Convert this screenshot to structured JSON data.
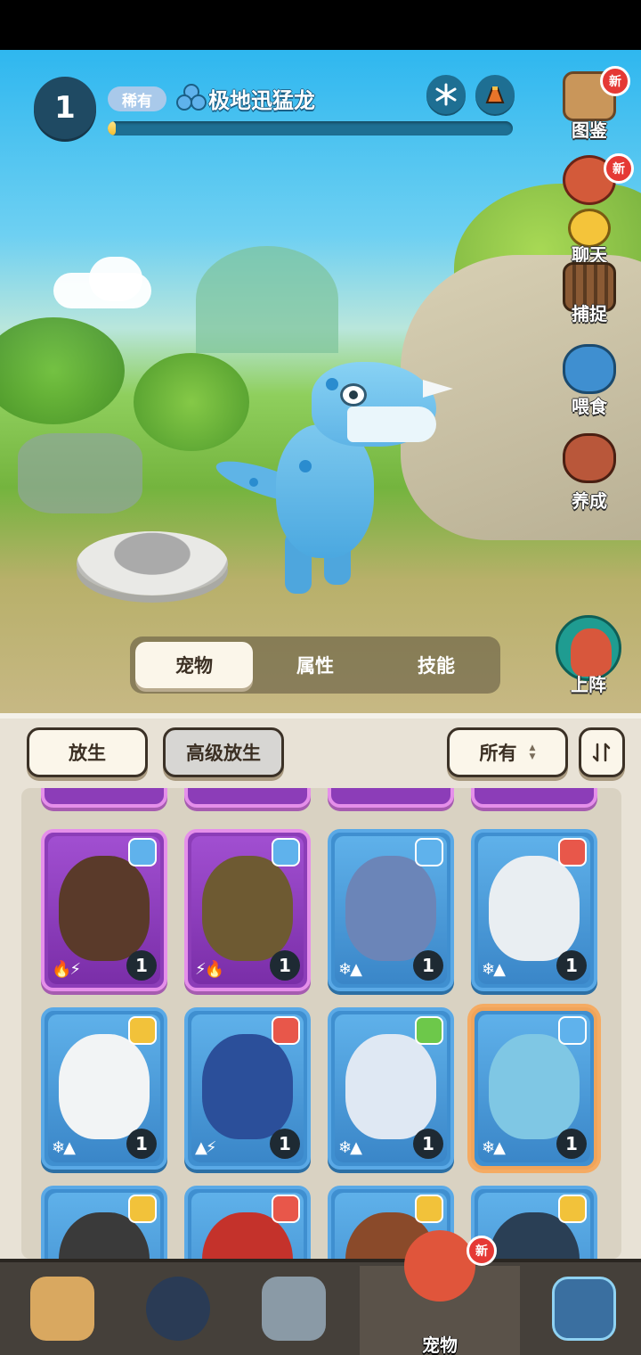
{
  "header": {
    "level": "1",
    "rarity": "稀有",
    "pet_name": "极地迅猛龙",
    "xp_progress_percent": 2,
    "element_icons": [
      "snowflake-icon",
      "volcano-icon"
    ]
  },
  "side_menu": [
    {
      "label": "图鉴",
      "badge": "新",
      "icon": "book-icon"
    },
    {
      "label": "",
      "badge": "新",
      "icon": "stall-icon"
    },
    {
      "label": "聊天",
      "badge": "",
      "icon": "chat-icon"
    },
    {
      "label": "捕捉",
      "badge": "",
      "icon": "cage-icon"
    },
    {
      "label": "喂食",
      "badge": "",
      "icon": "feed-icon"
    },
    {
      "label": "养成",
      "badge": "",
      "icon": "nurture-icon"
    }
  ],
  "detail_tabs": [
    "宠物",
    "属性",
    "技能"
  ],
  "active_detail_tab": 0,
  "deploy_label": "上阵",
  "panel": {
    "release_label": "放生",
    "advanced_release_label": "高级放生",
    "filter_label": "所有",
    "sort_icon": "sort-icon"
  },
  "pet_cards": [
    {
      "level": "1",
      "frame": "purple",
      "type_icon": "water-icon",
      "elements": "🔥⚡",
      "creature_color": "#5a3a2a"
    },
    {
      "level": "1",
      "frame": "purple",
      "type_icon": "water-icon",
      "elements": "⚡🔥",
      "creature_color": "#6e5a32"
    },
    {
      "level": "1",
      "frame": "blue",
      "type_icon": "water-icon",
      "elements": "❄▲",
      "creature_color": "#6b85b8"
    },
    {
      "level": "1",
      "frame": "blue",
      "type_icon": "fire-paw-icon",
      "elements": "❄▲",
      "creature_color": "#e9eef2"
    },
    {
      "level": "1",
      "frame": "blue",
      "type_icon": "earth-icon",
      "elements": "❄▲",
      "creature_color": "#f2f4f5"
    },
    {
      "level": "1",
      "frame": "blue",
      "type_icon": "fire-paw-icon",
      "elements": "▲⚡",
      "creature_color": "#2b4f9a"
    },
    {
      "level": "1",
      "frame": "blue",
      "type_icon": "leaf-heart-icon",
      "elements": "❄▲",
      "creature_color": "#dfe8f3"
    },
    {
      "level": "1",
      "frame": "blue",
      "type_icon": "water-icon",
      "elements": "❄▲",
      "creature_color": "#7fc7e4"
    },
    {
      "level": "",
      "frame": "blue",
      "type_icon": "earth-icon",
      "elements": "",
      "creature_color": "#3a3a3a"
    },
    {
      "level": "",
      "frame": "blue",
      "type_icon": "fire-paw-icon",
      "elements": "",
      "creature_color": "#c4322b"
    },
    {
      "level": "",
      "frame": "blue",
      "type_icon": "earth-icon",
      "elements": "",
      "creature_color": "#8a4a2a"
    },
    {
      "level": "",
      "frame": "blue",
      "type_icon": "earth-icon",
      "elements": "",
      "creature_color": "#2a3f55"
    }
  ],
  "selected_card_index": 7,
  "bottom_nav": [
    {
      "label": "",
      "icon": "tribe-icon"
    },
    {
      "label": "",
      "icon": "hero-icon"
    },
    {
      "label": "",
      "icon": "weapon-icon"
    },
    {
      "label": "宠物",
      "icon": "pet-icon",
      "badge": "新"
    },
    {
      "label": "",
      "icon": "portal-icon"
    }
  ],
  "colors": {
    "accent_blue": "#1e6f93",
    "card_blue": "#5aa9e6",
    "card_purple": "#e58fea",
    "new_badge": "#e53935",
    "selected": "#f5ab62"
  }
}
